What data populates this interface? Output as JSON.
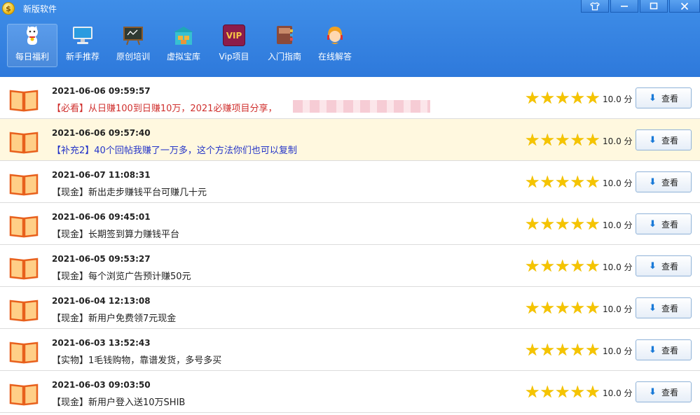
{
  "app": {
    "title": "新版软件",
    "icon": "coin-icon"
  },
  "window_controls": [
    "shirt-icon",
    "minimize-icon",
    "maximize-icon",
    "close-icon"
  ],
  "toolbar": {
    "items": [
      {
        "label": "每日福利",
        "icon": "lucky-cat-icon",
        "active": true
      },
      {
        "label": "新手推荐",
        "icon": "monitor-icon",
        "active": false
      },
      {
        "label": "原创培训",
        "icon": "blackboard-icon",
        "active": false
      },
      {
        "label": "虚拟宝库",
        "icon": "warehouse-icon",
        "active": false
      },
      {
        "label": "Vip项目",
        "icon": "vip-icon",
        "icon_text": "VIP",
        "active": false
      },
      {
        "label": "入门指南",
        "icon": "guide-book-icon",
        "active": false
      },
      {
        "label": "在线解答",
        "icon": "support-agent-icon",
        "active": false
      }
    ]
  },
  "list": {
    "rows": [
      {
        "date": "2021-06-06 09:59:57",
        "title": "【必看】从日赚100到日赚10万，2021必赚项目分享，",
        "color": "#d0302e",
        "rating": 5,
        "score": "10.0 分",
        "button": "查看",
        "redacted": true
      },
      {
        "date": "2021-06-06 09:57:40",
        "title": "【补充2】40个回帖我赚了一万多，这个方法你们也可以复制",
        "color": "#2434c8",
        "rating": 5,
        "score": "10.0 分",
        "button": "查看",
        "highlight": true
      },
      {
        "date": "2021-06-07 11:08:31",
        "title": "【现金】新出走步赚钱平台可赚几十元",
        "color": "#222222",
        "rating": 5,
        "score": "10.0 分",
        "button": "查看"
      },
      {
        "date": "2021-06-06 09:45:01",
        "title": "【现金】长期签到算力赚钱平台",
        "color": "#222222",
        "rating": 5,
        "score": "10.0 分",
        "button": "查看"
      },
      {
        "date": "2021-06-05 09:53:27",
        "title": "【现金】每个浏览广告预计赚50元",
        "color": "#222222",
        "rating": 5,
        "score": "10.0 分",
        "button": "查看"
      },
      {
        "date": "2021-06-04 12:13:08",
        "title": "【现金】新用户免费领7元现金",
        "color": "#222222",
        "rating": 5,
        "score": "10.0 分",
        "button": "查看"
      },
      {
        "date": "2021-06-03 13:52:43",
        "title": "【实物】1毛钱购物，靠谱发货，多号多买",
        "color": "#222222",
        "rating": 5,
        "score": "10.0 分",
        "button": "查看"
      },
      {
        "date": "2021-06-03 09:03:50",
        "title": "【现金】新用户登入送10万SHIB",
        "color": "#222222",
        "rating": 5,
        "score": "10.0 分",
        "button": "查看"
      }
    ]
  }
}
